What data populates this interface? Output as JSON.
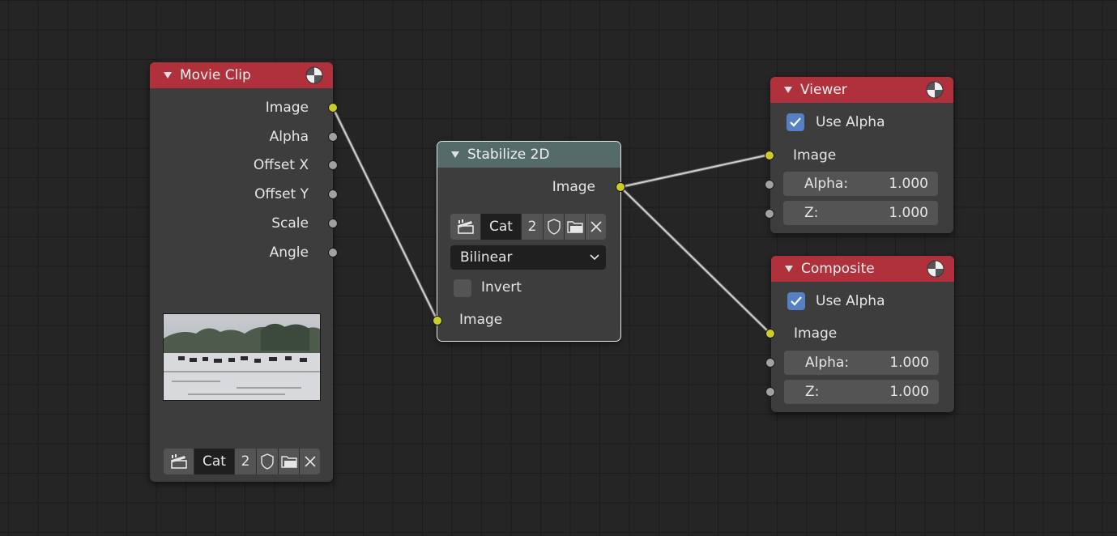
{
  "colors": {
    "background": "#252525",
    "node_body": "#3d3d3d",
    "header_output": "#b0313c",
    "header_distort": "#546b6a",
    "socket_image": "#cccc2a",
    "socket_value": "#a1a1a1",
    "checkbox_on": "#5680c2",
    "link": "#c8c8c8"
  },
  "movie_clip": {
    "title": "Movie Clip",
    "header_icon": "render-layer-icon",
    "outputs": [
      "Image",
      "Alpha",
      "Offset X",
      "Offset Y",
      "Scale",
      "Angle"
    ],
    "preview_icon": "snowy-field-cattle-thumbnail",
    "clip_selector": {
      "icon": "clip-icon",
      "name": "Cat",
      "users": "2",
      "fake_user_icon": "shield-icon",
      "open_icon": "folder-icon",
      "unlink_icon": "close-icon"
    }
  },
  "stabilize": {
    "title": "Stabilize 2D",
    "output": "Image",
    "clip_selector": {
      "icon": "clip-icon",
      "name": "Cat",
      "users": "2",
      "fake_user_icon": "shield-icon",
      "open_icon": "folder-icon",
      "unlink_icon": "close-icon"
    },
    "filter": "Bilinear",
    "invert_label": "Invert",
    "invert_checked": false,
    "input": "Image"
  },
  "viewer": {
    "title": "Viewer",
    "header_icon": "render-layer-icon",
    "use_alpha_label": "Use Alpha",
    "use_alpha_checked": true,
    "input_image": "Image",
    "alpha_label": "Alpha:",
    "alpha_value": "1.000",
    "z_label": "Z:",
    "z_value": "1.000"
  },
  "composite": {
    "title": "Composite",
    "header_icon": "render-layer-icon",
    "use_alpha_label": "Use Alpha",
    "use_alpha_checked": true,
    "input_image": "Image",
    "alpha_label": "Alpha:",
    "alpha_value": "1.000",
    "z_label": "Z:",
    "z_value": "1.000"
  }
}
